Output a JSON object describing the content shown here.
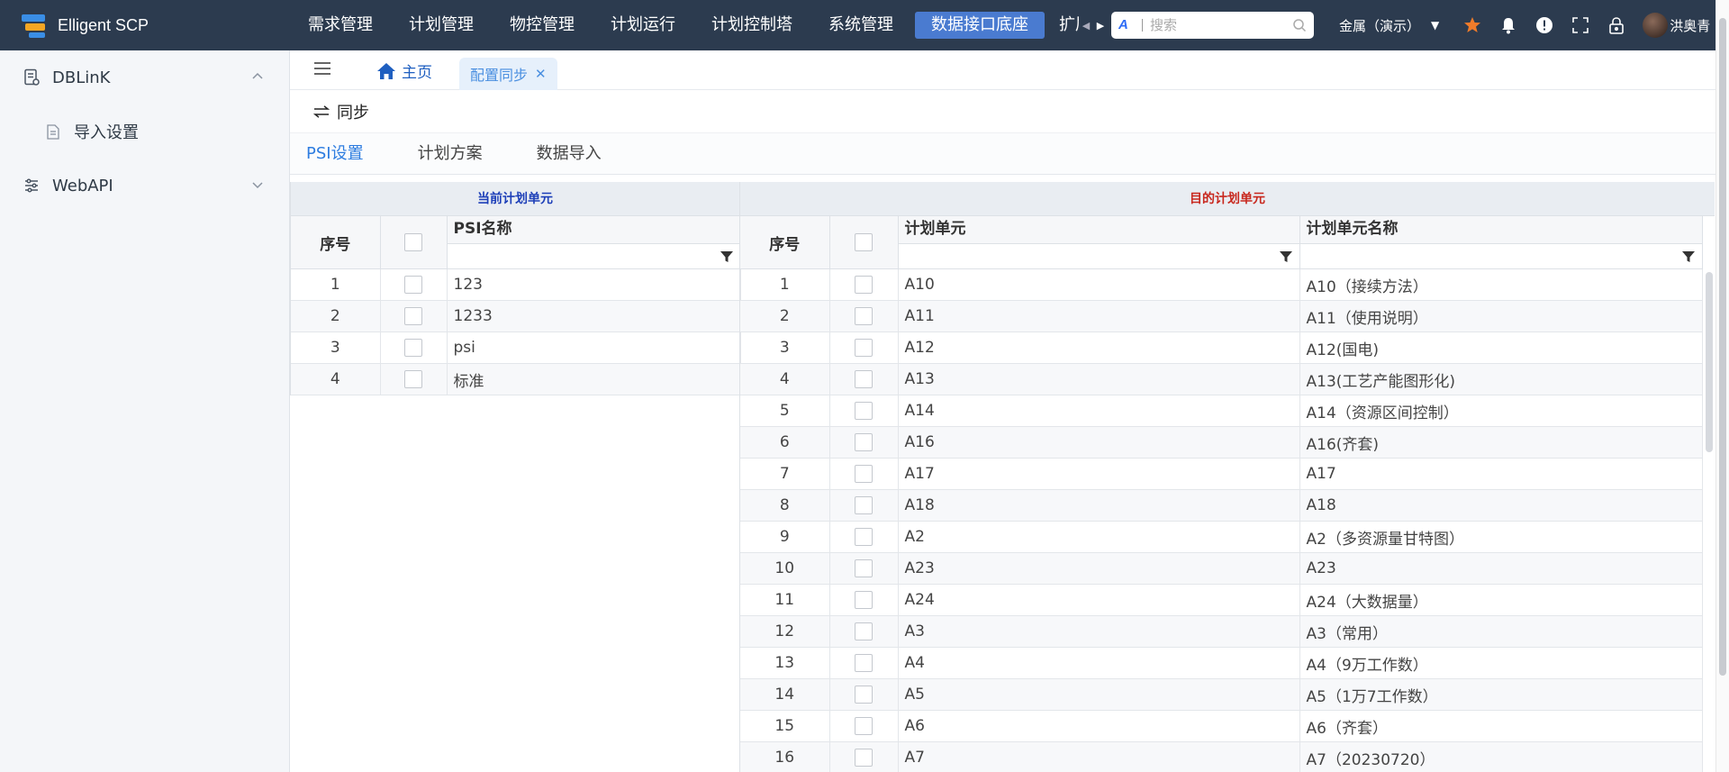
{
  "app": {
    "name": "Elligent SCP"
  },
  "nav": {
    "items": [
      "需求管理",
      "计划管理",
      "物控管理",
      "计划运行",
      "计划控制塔",
      "系统管理",
      "数据接口底座"
    ],
    "active_index": 6,
    "overflow_label": "扩展"
  },
  "search": {
    "placeholder": "搜索"
  },
  "header": {
    "tenant": "金属（演示）",
    "user": "洪奥青"
  },
  "sidebar": {
    "groups": [
      {
        "label": "DBLinK",
        "expanded": true,
        "children": [
          {
            "label": "导入设置"
          }
        ]
      },
      {
        "label": "WebAPI",
        "expanded": false
      }
    ]
  },
  "tabs": {
    "home": "主页",
    "active": "配置同步"
  },
  "toolbar": {
    "sync_label": "同步"
  },
  "subtabs": [
    "PSI设置",
    "计划方案",
    "数据导入"
  ],
  "left_grid": {
    "title": "当前计划单元",
    "col_index": "序号",
    "col_name": "PSI名称",
    "rows": [
      {
        "index": "1",
        "name": "123"
      },
      {
        "index": "2",
        "name": "1233"
      },
      {
        "index": "3",
        "name": "psi"
      },
      {
        "index": "4",
        "name": "标准"
      }
    ]
  },
  "right_grid": {
    "title": "目的计划单元",
    "col_index": "序号",
    "col_unit": "计划单元",
    "col_unit_name": "计划单元名称",
    "rows": [
      {
        "index": "1",
        "unit": "A10",
        "name": "A10（接续方法）"
      },
      {
        "index": "2",
        "unit": "A11",
        "name": "A11（使用说明）"
      },
      {
        "index": "3",
        "unit": "A12",
        "name": "A12(国电)"
      },
      {
        "index": "4",
        "unit": "A13",
        "name": "A13(工艺产能图形化)"
      },
      {
        "index": "5",
        "unit": "A14",
        "name": "A14（资源区间控制）"
      },
      {
        "index": "6",
        "unit": "A16",
        "name": "A16(齐套)"
      },
      {
        "index": "7",
        "unit": "A17",
        "name": "A17"
      },
      {
        "index": "8",
        "unit": "A18",
        "name": "A18"
      },
      {
        "index": "9",
        "unit": "A2",
        "name": "A2（多资源量甘特图）"
      },
      {
        "index": "10",
        "unit": "A23",
        "name": "A23"
      },
      {
        "index": "11",
        "unit": "A24",
        "name": "A24（大数据量）"
      },
      {
        "index": "12",
        "unit": "A3",
        "name": "A3（常用）"
      },
      {
        "index": "13",
        "unit": "A4",
        "name": "A4（9万工作数）"
      },
      {
        "index": "14",
        "unit": "A5",
        "name": "A5（1万7工作数）"
      },
      {
        "index": "15",
        "unit": "A6",
        "name": "A6（齐套）"
      },
      {
        "index": "16",
        "unit": "A7",
        "name": "A7（20230720）"
      }
    ]
  },
  "colors": {
    "topbar": "#2c3b4f",
    "nav_active": "#4a7bd0",
    "accent": "#2e7de0",
    "star": "#f07b2a"
  }
}
